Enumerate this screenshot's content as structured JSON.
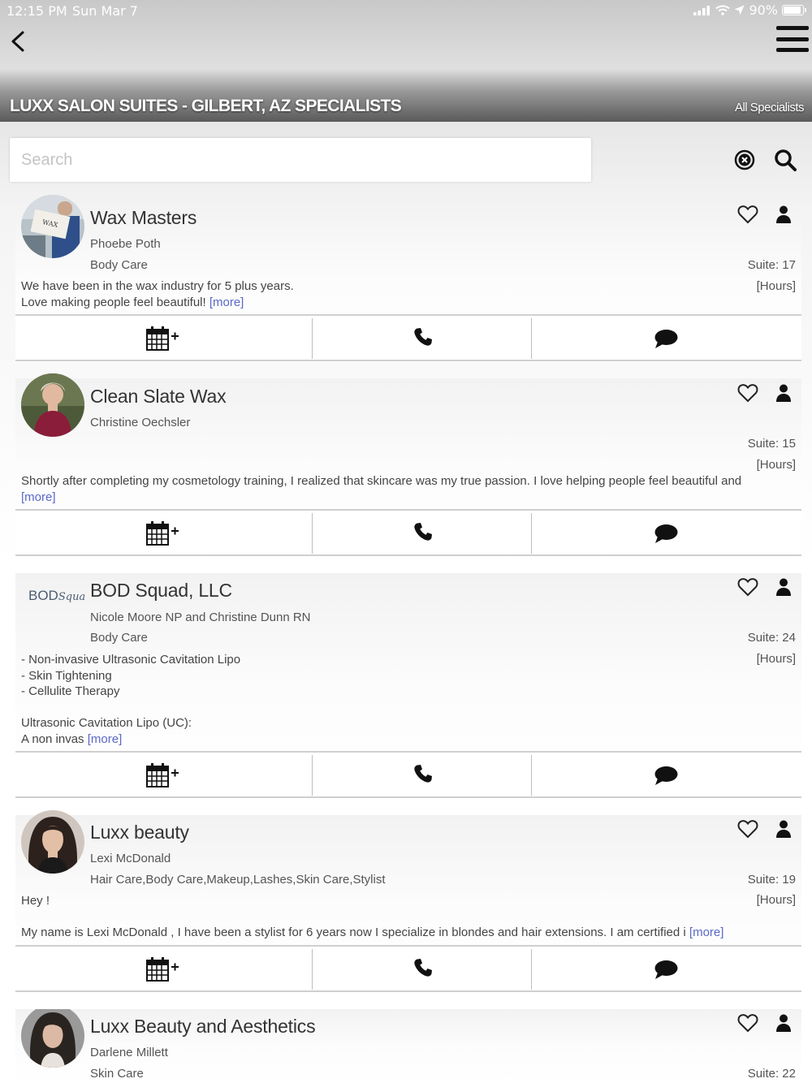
{
  "status": {
    "time": "12:15 PM",
    "date": "Sun Mar 7",
    "battery": "90%",
    "battery_fraction": 0.9
  },
  "header": {
    "title": "LUXX SALON SUITES - GILBERT, AZ SPECIALISTS",
    "all_link": "All Specialists"
  },
  "search": {
    "placeholder": "Search",
    "value": ""
  },
  "listings": [
    {
      "name": "Wax Masters",
      "owner": "Phoebe Poth",
      "category": "Body Care",
      "suite": "Suite: 17",
      "hours": "[Hours]",
      "description": "We have been in the wax industry for 5 plus years.\nLove making people feel beautiful! ",
      "more": "[more]"
    },
    {
      "name": "Clean Slate Wax",
      "owner": "Christine Oechsler",
      "category": "",
      "suite": "Suite: 15",
      "hours": "[Hours]",
      "description": "Shortly after completing my cosmetology training, I realized that skincare was my true passion. I love helping people feel beautiful and\n",
      "more": "[more]"
    },
    {
      "name": "BOD Squad, LLC",
      "owner": "Nicole Moore NP and Christine Dunn RN",
      "category": "Body Care",
      "suite": "Suite: 24",
      "hours": "[Hours]",
      "logo_text": "BOD",
      "logo_script": "Squad",
      "description": "- Non-invasive Ultrasonic Cavitation Lipo\n- Skin Tightening\n- Cellulite Therapy\n\nUltrasonic Cavitation Lipo (UC):\nA non invas ",
      "more": "[more]"
    },
    {
      "name": "Luxx beauty",
      "owner": "Lexi McDonald",
      "category": "Hair Care,Body Care,Makeup,Lashes,Skin Care,Stylist",
      "suite": "Suite: 19",
      "hours": "[Hours]",
      "description": "Hey !\n\nMy name is Lexi McDonald , I have been a stylist for 6 years now I specialize in blondes and hair extensions. I am certified i ",
      "more": "[more]"
    },
    {
      "name": "Luxx Beauty and Aesthetics",
      "owner": "Darlene Millett",
      "category": "Skin Care",
      "suite": "Suite: 22"
    }
  ],
  "action_plus": "+",
  "icons": {
    "back": "chevron-left-icon",
    "menu": "hamburger-menu-icon",
    "clear": "clear-circle-x-icon",
    "search": "magnifier-icon",
    "favorite": "heart-outline-icon",
    "profile": "person-icon",
    "book": "calendar-plus-icon",
    "call": "phone-icon",
    "message": "chat-bubble-icon"
  },
  "colors": {
    "more_link": "#5a68c8",
    "header_text": "#ffffff"
  }
}
